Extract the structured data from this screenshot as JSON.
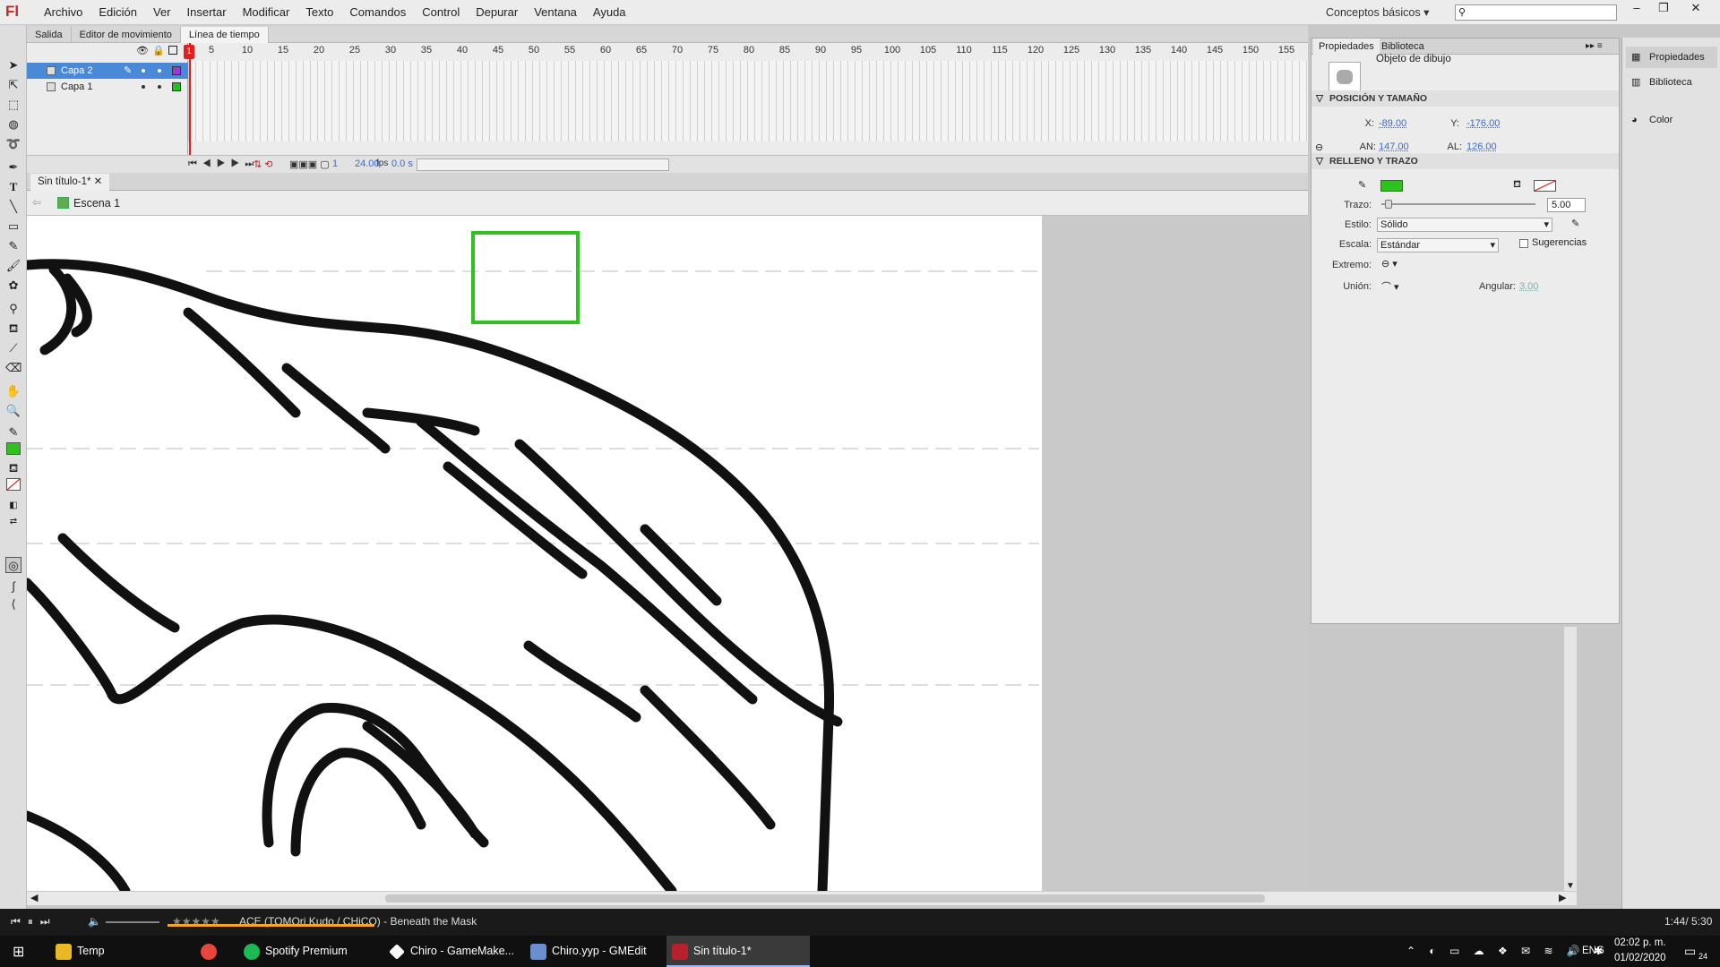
{
  "app": {
    "logo": "Fl",
    "menus": [
      "Archivo",
      "Edición",
      "Ver",
      "Insertar",
      "Modificar",
      "Texto",
      "Comandos",
      "Control",
      "Depurar",
      "Ventana",
      "Ayuda"
    ],
    "workspace": "Conceptos básicos"
  },
  "panel_tabs": [
    "Salida",
    "Editor de movimiento",
    "Línea de tiempo"
  ],
  "timeline": {
    "layers": [
      {
        "name": "Capa 2",
        "color": "#9a3ad6"
      },
      {
        "name": "Capa 1",
        "color": "#22c022"
      }
    ],
    "ruler": [
      "5",
      "10",
      "15",
      "20",
      "25",
      "30",
      "35",
      "40",
      "45",
      "50",
      "55",
      "60",
      "65",
      "70",
      "75",
      "80",
      "85",
      "90",
      "95",
      "100",
      "105",
      "110",
      "115",
      "120",
      "125",
      "130",
      "135",
      "140",
      "145",
      "150",
      "155"
    ],
    "current_frame": "1",
    "fps": "24.00",
    "fps_unit": "fps",
    "time": "0.0 s",
    "playhead_label": "1"
  },
  "document": {
    "tab": "Sin título-1*",
    "scene": "Escena 1"
  },
  "properties": {
    "tabs": [
      "Propiedades",
      "Biblioteca"
    ],
    "object_type": "Objeto de dibujo",
    "section_position": "POSICIÓN Y TAMAÑO",
    "x_label": "X:",
    "x": "-89.00",
    "y_label": "Y:",
    "y": "-176.00",
    "w_label": "AN:",
    "w": "147.00",
    "h_label": "AL:",
    "h": "126.00",
    "section_fill": "RELLENO Y TRAZO",
    "stroke_color": "#2fc21f",
    "trazo_label": "Trazo:",
    "trazo": "5.00",
    "estilo_label": "Estilo:",
    "estilo": "Sólido",
    "escala_label": "Escala:",
    "escala": "Estándar",
    "sugerencias": "Sugerencias",
    "extremo_label": "Extremo:",
    "union_label": "Unión:",
    "angular_label": "Angular:",
    "angular": "3.00"
  },
  "dock": [
    "Propiedades",
    "Biblioteca",
    "Color"
  ],
  "music": {
    "track": "ACE (TOMOri Kudo / CHiCO) - Beneath the Mask",
    "time": "1:44/ 5:30",
    "rating": "★★★★★",
    "progress": 0.42
  },
  "taskbar": {
    "apps": [
      {
        "label": "Temp",
        "color": "#e8b923"
      },
      {
        "label": "",
        "color": "#e8463a"
      },
      {
        "label": "Spotify Premium",
        "color": "#1db954"
      },
      {
        "label": "Chiro - GameMake...",
        "color": "#ffffff"
      },
      {
        "label": "Chiro.yyp - GMEdit",
        "color": "#6a8fd0"
      },
      {
        "label": "Sin título-1*",
        "color": "#b8202c"
      }
    ],
    "lang": "ENG",
    "clock_time": "02:02 p. m.",
    "clock_date": "01/02/2020",
    "notif": "24"
  }
}
